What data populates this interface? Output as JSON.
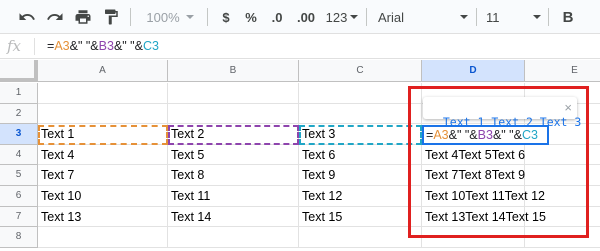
{
  "toolbar": {
    "zoom": "100%",
    "currency": "$",
    "percent": "%",
    "decrease_decimals": ".0",
    "increase_decimals": ".00",
    "more_formats": "123",
    "font": "Arial",
    "font_size": "11",
    "bold": "B",
    "icons": [
      "undo-icon",
      "redo-icon",
      "print-icon",
      "paint-format-icon"
    ]
  },
  "formula_bar": {
    "fx_label": "fx",
    "formula_parts": [
      "=",
      "A3",
      "&\" \"&",
      "B3",
      "&\" \"&",
      "C3"
    ]
  },
  "columns": [
    "A",
    "B",
    "C",
    "D",
    "E"
  ],
  "selected_column": "D",
  "rows": [
    {
      "num": "1",
      "cells": [
        "",
        "",
        "",
        "",
        ""
      ]
    },
    {
      "num": "2",
      "cells": [
        "",
        "",
        "",
        "",
        ""
      ]
    },
    {
      "num": "3",
      "cells": [
        "Text 1",
        "Text 2",
        "Text 3",
        "",
        ""
      ]
    },
    {
      "num": "4",
      "cells": [
        "Text 4",
        "Text 5",
        "Text 6",
        "Text 4Text 5Text 6",
        ""
      ]
    },
    {
      "num": "5",
      "cells": [
        "Text 7",
        "Text 8",
        "Text 9",
        "Text 7Text 8Text 9",
        ""
      ]
    },
    {
      "num": "6",
      "cells": [
        "Text 10",
        "Text 11",
        "Text 12",
        "Text 10Text 11Text 12",
        ""
      ]
    },
    {
      "num": "7",
      "cells": [
        "Text 13",
        "Text 14",
        "Text 15",
        "Text 13Text 14Text 15",
        ""
      ]
    },
    {
      "num": "8",
      "cells": [
        "",
        "",
        "",
        "",
        ""
      ]
    }
  ],
  "selected_row": "3",
  "tooltip": {
    "preview": "Text 1 Text 2 Text 3",
    "close": "×"
  },
  "colors": {
    "ref_a": "#e69138",
    "ref_b": "#8e44ad",
    "ref_c": "#21a6c6",
    "highlight_box": "#e0201f",
    "active_blue": "#1a73e8"
  }
}
